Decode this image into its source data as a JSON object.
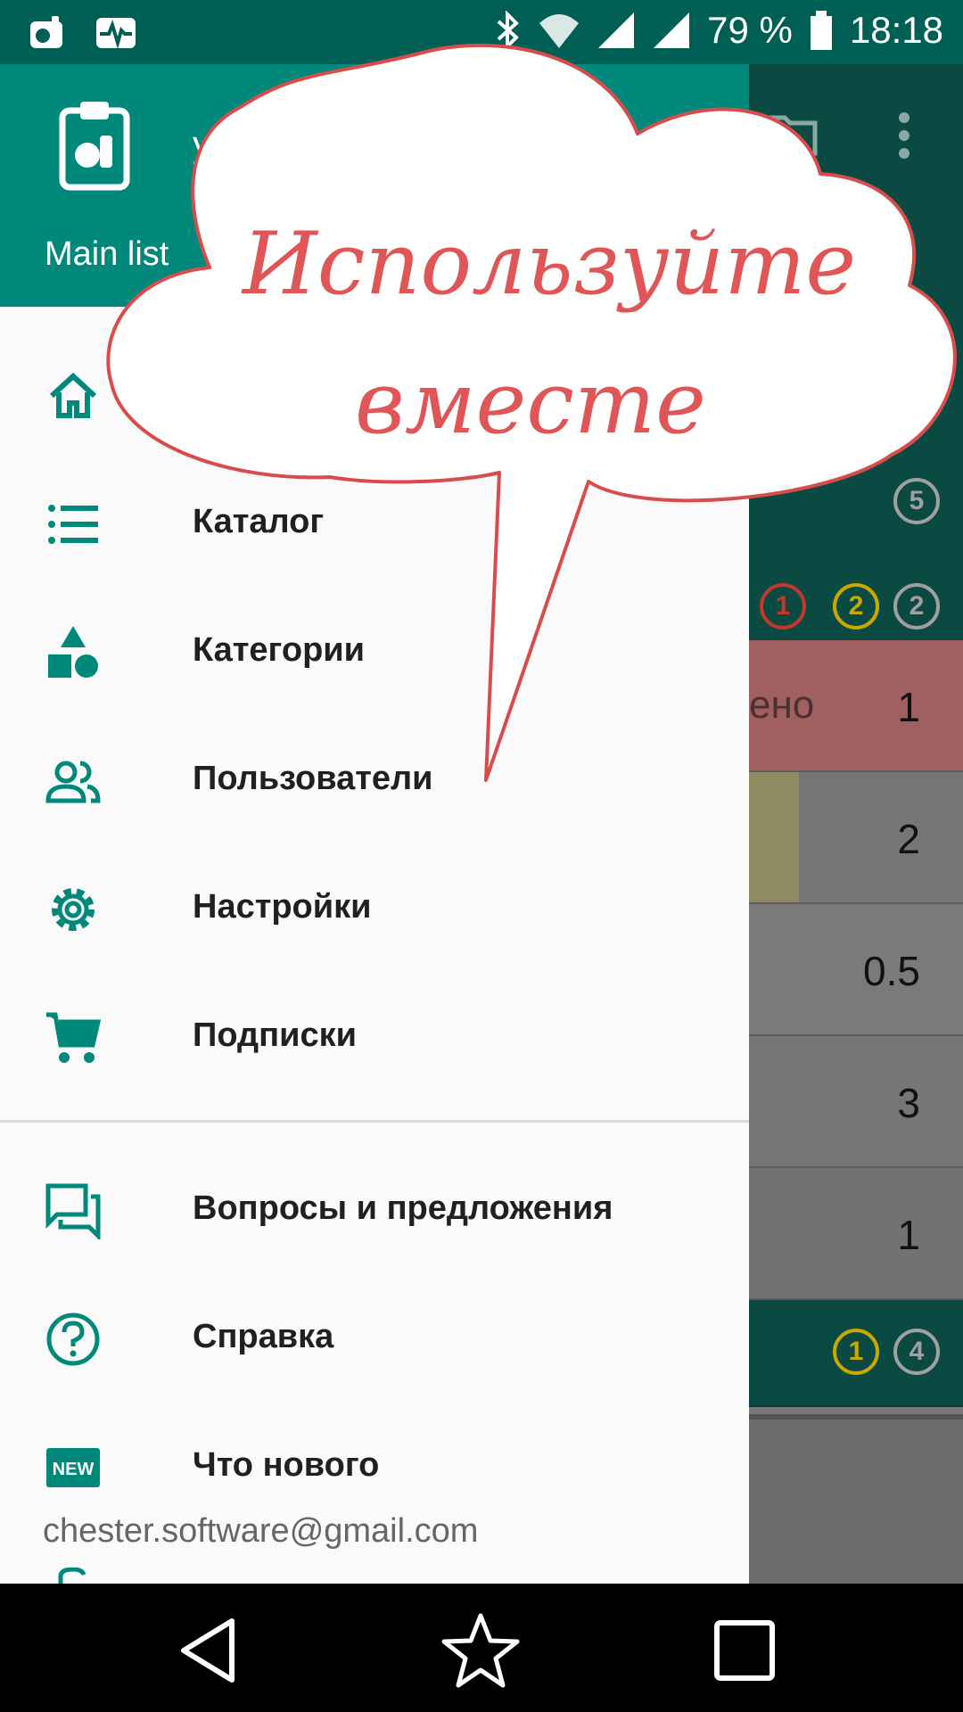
{
  "status_bar": {
    "icons_left": [
      "shopping-app-icon",
      "activity-icon"
    ],
    "icons_right": [
      "bluetooth-icon",
      "wifi-icon",
      "signal-icon",
      "signal-icon"
    ],
    "battery_percent": "79 %",
    "time": "18:18"
  },
  "drawer": {
    "username": "у",
    "list_name": "Main list",
    "items": [
      {
        "label": "",
        "icon": "home-icon"
      },
      {
        "label": "Каталог",
        "icon": "list-icon"
      },
      {
        "label": "Категории",
        "icon": "shapes-icon"
      },
      {
        "label": "Пользователи",
        "icon": "users-icon"
      },
      {
        "label": "Настройки",
        "icon": "gear-icon"
      },
      {
        "label": "Подписки",
        "icon": "cart-icon"
      },
      {
        "label": "Вопросы и предложения",
        "icon": "chat-icon"
      },
      {
        "label": "Справка",
        "icon": "help-icon"
      },
      {
        "label": "Что нового",
        "icon": "new-icon"
      }
    ],
    "email": "chester.software@gmail.com"
  },
  "main": {
    "group_rows": [
      {
        "counts": [
          "5"
        ]
      },
      {
        "counts": [
          "1",
          "2",
          "2"
        ]
      },
      {
        "counts": [
          "1",
          "4"
        ]
      }
    ],
    "items": [
      {
        "extra": "ено",
        "qty": "1"
      },
      {
        "extra": "",
        "qty": "2"
      },
      {
        "extra": "",
        "qty": "0.5"
      },
      {
        "extra": "",
        "qty": "3"
      },
      {
        "extra": "",
        "qty": "1"
      }
    ]
  },
  "promo": {
    "line1": "Используйте",
    "line2": "вместе"
  },
  "colors": {
    "primary": "#00897b",
    "status_bar": "#005f55",
    "accent_red": "#e05555",
    "count_red": "#c0392b",
    "count_yellow": "#c9a800",
    "count_grey": "#a0a0a0"
  }
}
